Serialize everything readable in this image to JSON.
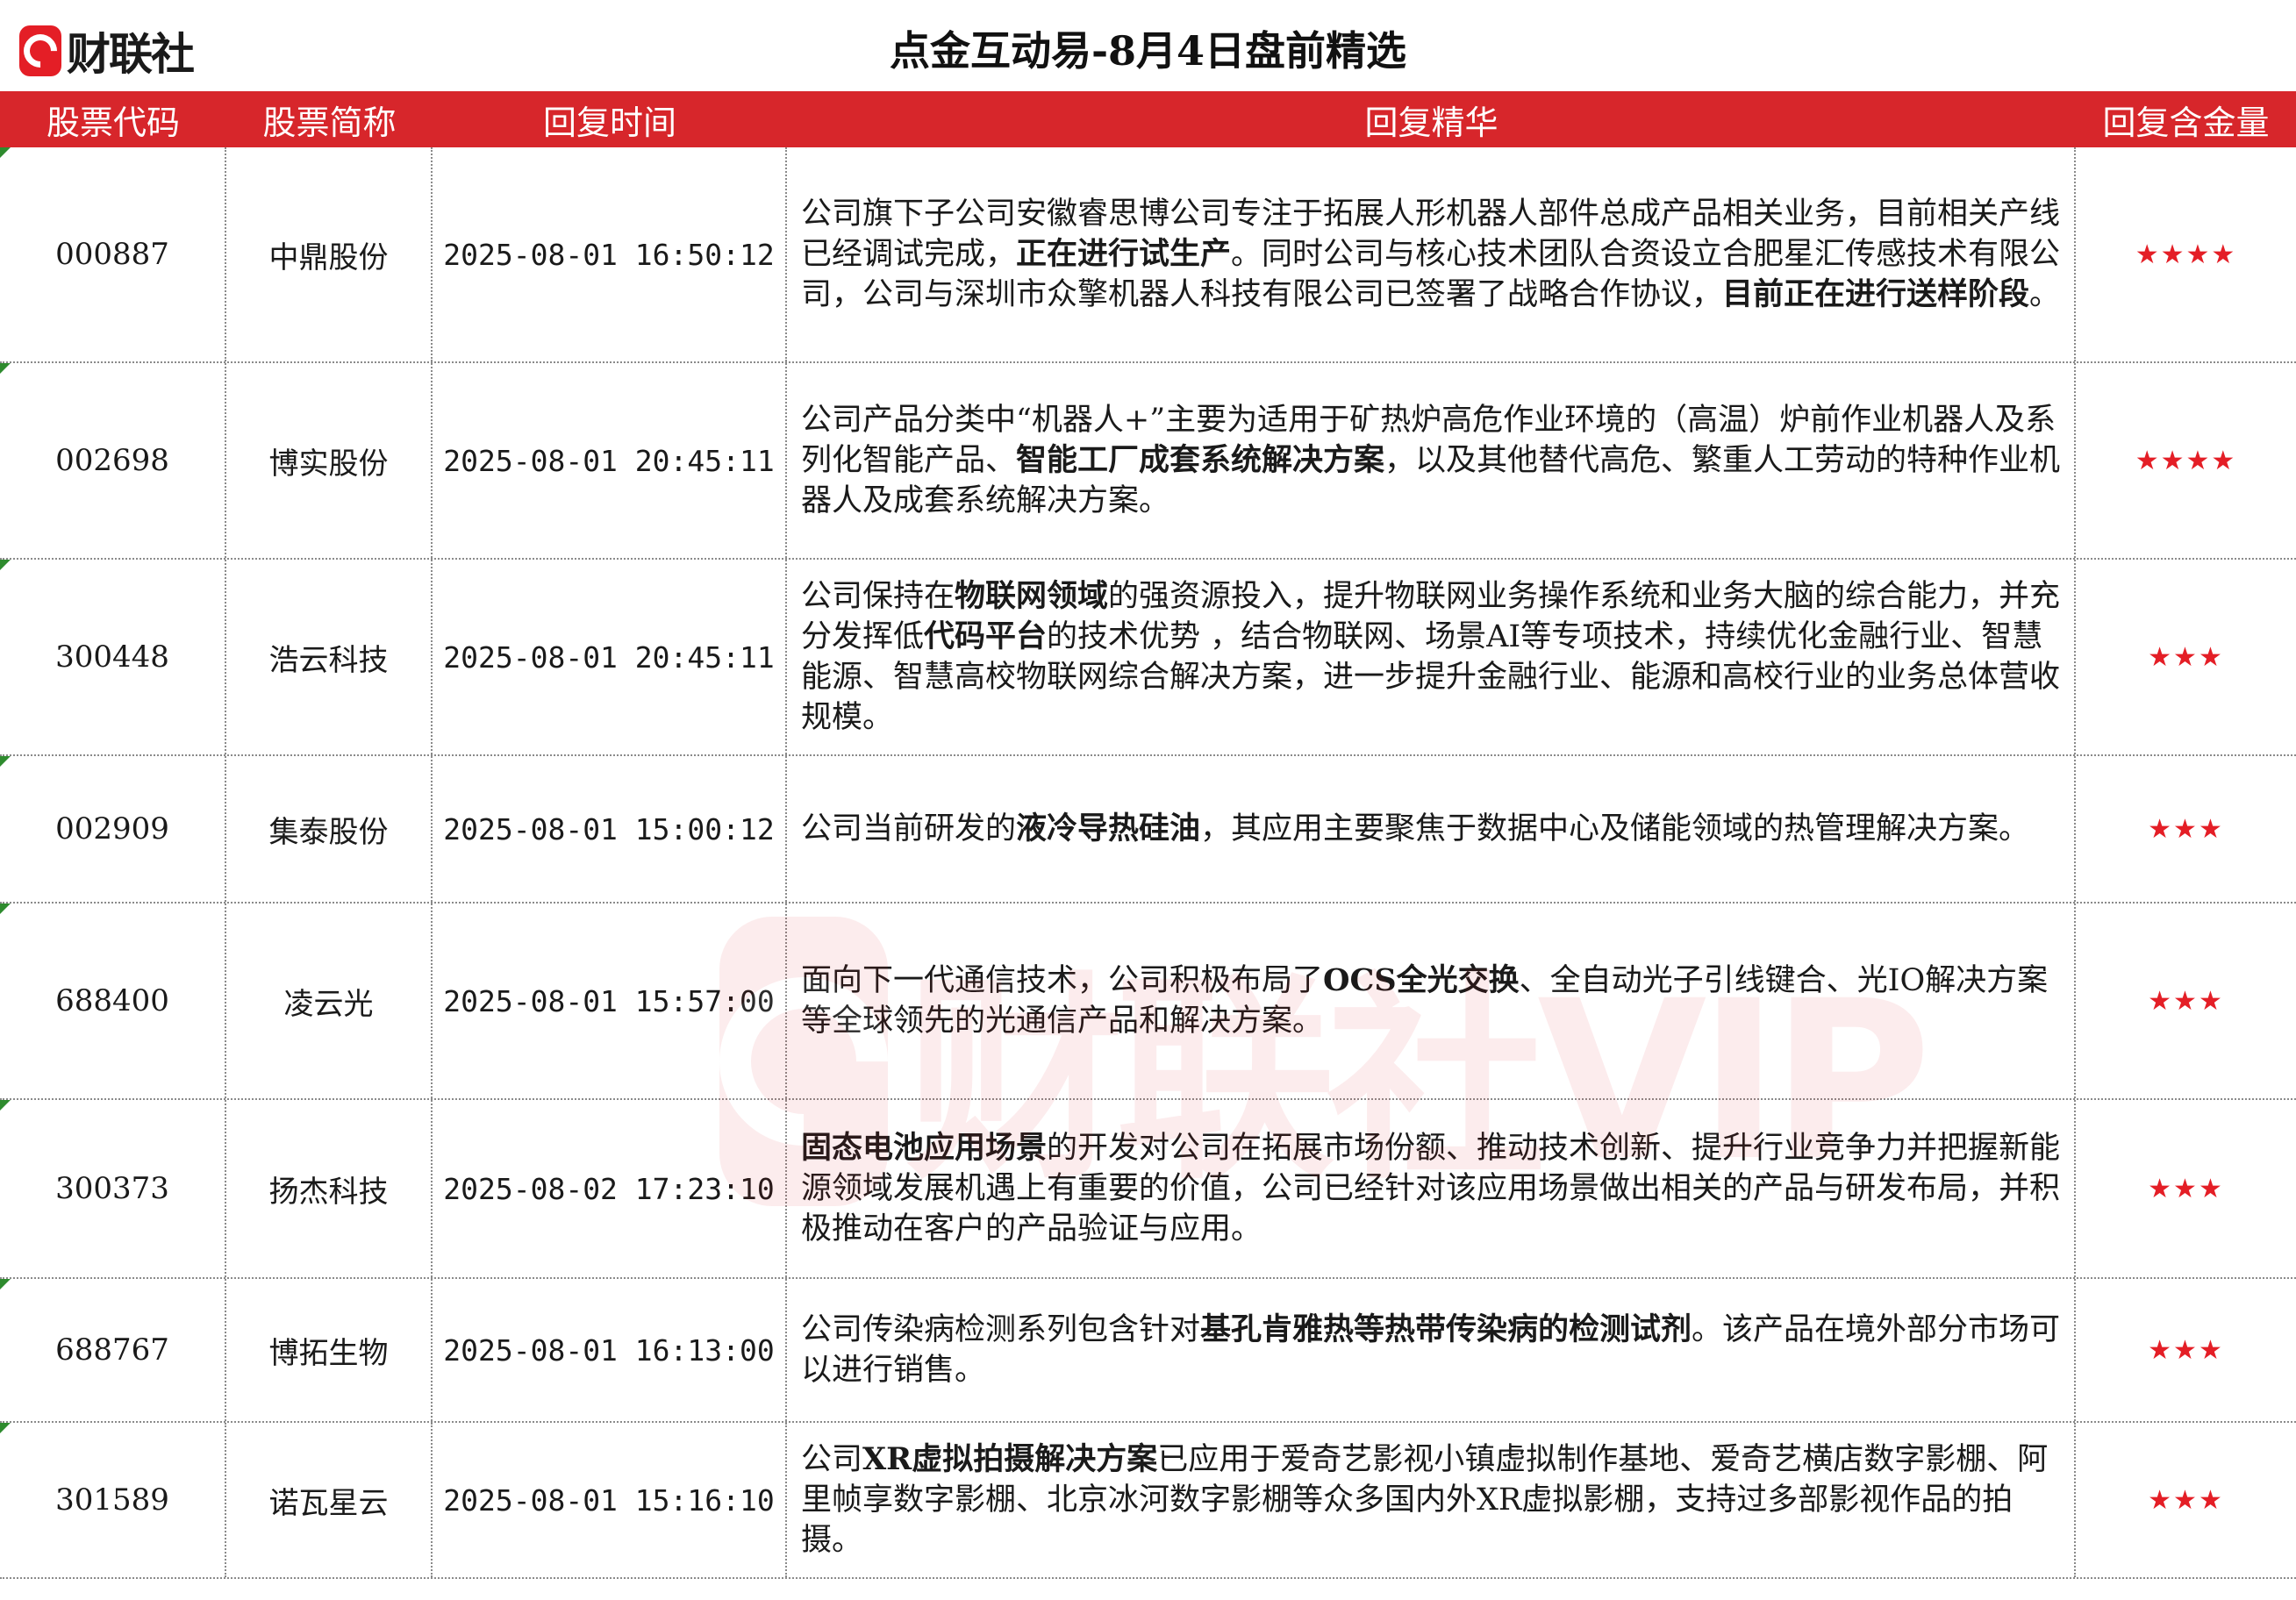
{
  "brand": {
    "logo_text": "财联社",
    "watermark_text": "财联社VIP"
  },
  "title": "点金互动易-8月4日盘前精选",
  "columns": [
    "股票代码",
    "股票简称",
    "回复时间",
    "回复精华",
    "回复含金量"
  ],
  "colors": {
    "header_bg": "#d7262b",
    "star": "#e41e26"
  },
  "rows": [
    {
      "code": "000887",
      "name": "中鼎股份",
      "time": "2025-08-01 16:50:12",
      "segments": [
        {
          "t": "公司旗下子公司安徽睿思博公司专注于拓展人形机器人部件总成产品相关业务，目前相关产线已经调试完成，"
        },
        {
          "t": "正在进行试生产",
          "b": true
        },
        {
          "t": "。同时公司与核心技术团队合资设立合肥星汇传感技术有限公司，公司与深圳市众擎机器人科技有限公司已签署了战略合作协议，"
        },
        {
          "t": "目前正在进行送样阶段",
          "b": true
        },
        {
          "t": "。"
        }
      ],
      "rating": "★★★★"
    },
    {
      "code": "002698",
      "name": "博实股份",
      "time": "2025-08-01 20:45:11",
      "segments": [
        {
          "t": "公司产品分类中“机器人+”主要为适用于矿热炉高危作业环境的（高温）炉前作业机器人及系列化智能产品、"
        },
        {
          "t": "智能工厂成套系统解决方案",
          "b": true
        },
        {
          "t": "，以及其他替代高危、繁重人工劳动的特种作业机器人及成套系统解决方案。"
        }
      ],
      "rating": "★★★★"
    },
    {
      "code": "300448",
      "name": "浩云科技",
      "time": "2025-08-01 20:45:11",
      "segments": [
        {
          "t": "公司保持在"
        },
        {
          "t": "物联网领域",
          "b": true
        },
        {
          "t": "的强资源投入，提升物联网业务操作系统和业务大脑的综合能力，并充分发挥低"
        },
        {
          "t": "代码平台",
          "b": true
        },
        {
          "t": "的技术优势 ，结合物联网、场景AI等专项技术，持续优化金融行业、智慧能源、智慧高校物联网综合解决方案，进一步提升金融行业、能源和高校行业的业务总体营收规模。"
        }
      ],
      "rating": "★★★"
    },
    {
      "code": "002909",
      "name": "集泰股份",
      "time": "2025-08-01 15:00:12",
      "segments": [
        {
          "t": "公司当前研发的"
        },
        {
          "t": "液冷导热硅油",
          "b": true
        },
        {
          "t": "，其应用主要聚焦于数据中心及储能领域的热管理解决方案。"
        }
      ],
      "rating": "★★★"
    },
    {
      "code": "688400",
      "name": "凌云光",
      "time": "2025-08-01 15:57:00",
      "segments": [
        {
          "t": "面向下一代通信技术，公司积极布局了"
        },
        {
          "t": "OCS全光交换",
          "b": true
        },
        {
          "t": "、全自动光子引线键合、光IO解决方案等全球领先的光通信产品和解决方案。"
        }
      ],
      "rating": "★★★"
    },
    {
      "code": "300373",
      "name": "扬杰科技",
      "time": "2025-08-02 17:23:10",
      "segments": [
        {
          "t": "固态电池应用场景",
          "b": true
        },
        {
          "t": "的开发对公司在拓展市场份额、推动技术创新、提升行业竞争力并把握新能源领域发展机遇上有重要的价值，公司已经针对该应用场景做出相关的产品与研发布局，并积极推动在客户的产品验证与应用。"
        }
      ],
      "rating": "★★★"
    },
    {
      "code": "688767",
      "name": "博拓生物",
      "time": "2025-08-01 16:13:00",
      "segments": [
        {
          "t": "公司传染病检测系列包含针对"
        },
        {
          "t": "基孔肯雅热等热带传染病的检测试剂",
          "b": true
        },
        {
          "t": "。该产品在境外部分市场可以进行销售。"
        }
      ],
      "rating": "★★★"
    },
    {
      "code": "301589",
      "name": "诺瓦星云",
      "time": "2025-08-01 15:16:10",
      "segments": [
        {
          "t": "公司"
        },
        {
          "t": "XR虚拟拍摄解决方案",
          "b": true
        },
        {
          "t": "已应用于爱奇艺影视小镇虚拟制作基地、爱奇艺横店数字影棚、阿里帧享数字影棚、北京冰河数字影棚等众多国内外XR虚拟影棚，支持过多部影视作品的拍摄。"
        }
      ],
      "rating": "★★★"
    }
  ]
}
